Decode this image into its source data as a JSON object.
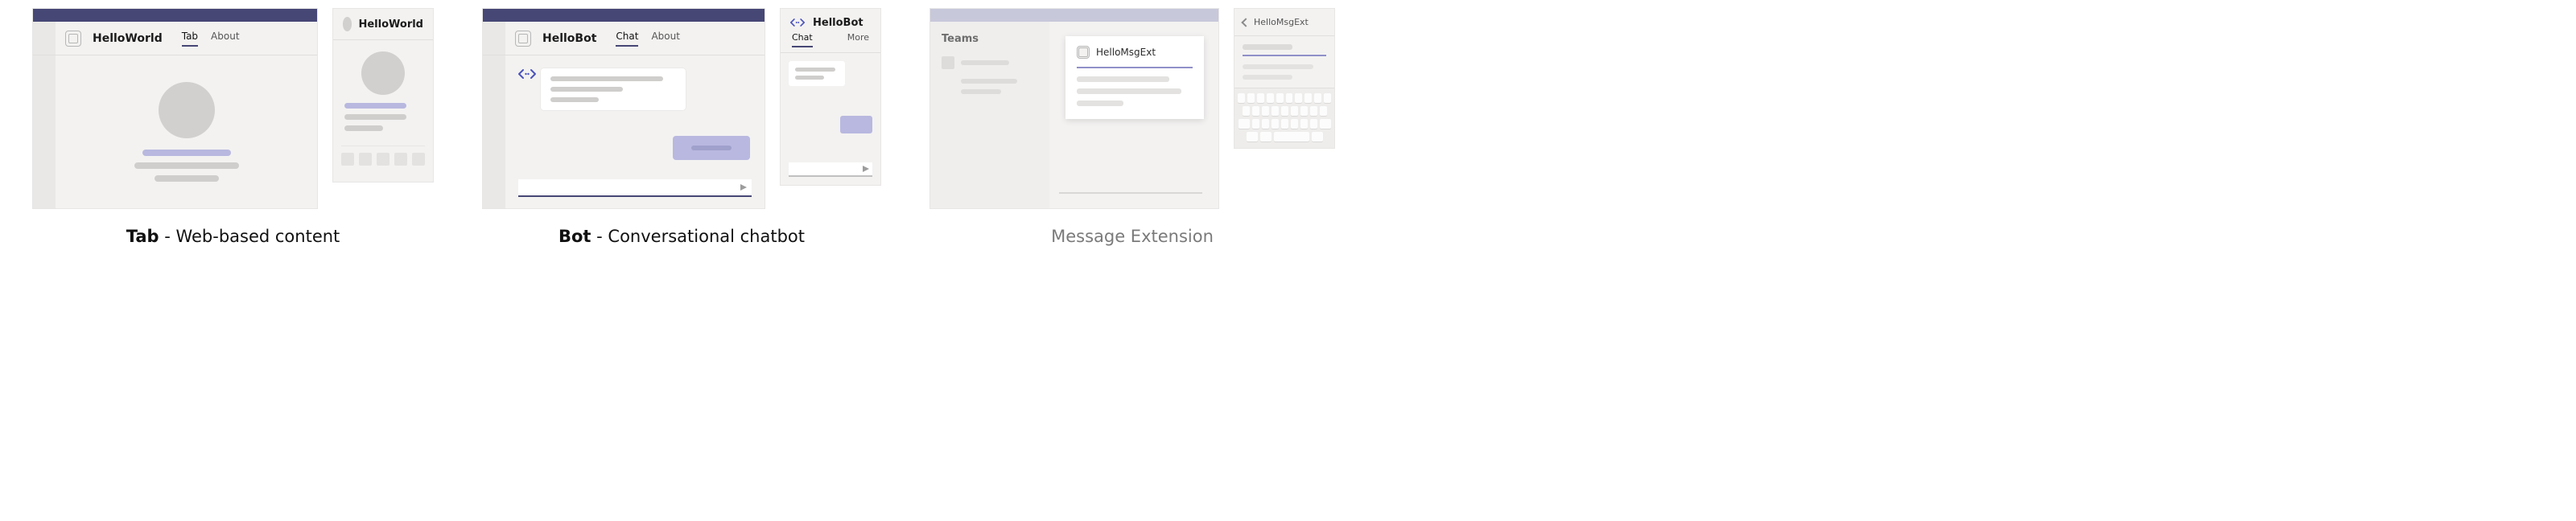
{
  "tab": {
    "desktop": {
      "title": "HelloWorld",
      "pivots": {
        "tab": "Tab",
        "about": "About"
      }
    },
    "mobile": {
      "title": "HelloWorld"
    },
    "caption_bold": "Tab",
    "caption_rest": " - Web-based content"
  },
  "bot": {
    "desktop": {
      "title": "HelloBot",
      "pivots": {
        "chat": "Chat",
        "about": "About"
      }
    },
    "mobile": {
      "title": "HelloBot",
      "tabs": {
        "chat": "Chat",
        "more": "More"
      }
    },
    "caption_bold": "Bot",
    "caption_rest": " - Conversational chatbot"
  },
  "msgext": {
    "desktop": {
      "rail_title": "Teams",
      "card_title": "HelloMsgExt"
    },
    "mobile": {
      "title": "HelloMsgExt"
    },
    "caption": "Message Extension"
  }
}
